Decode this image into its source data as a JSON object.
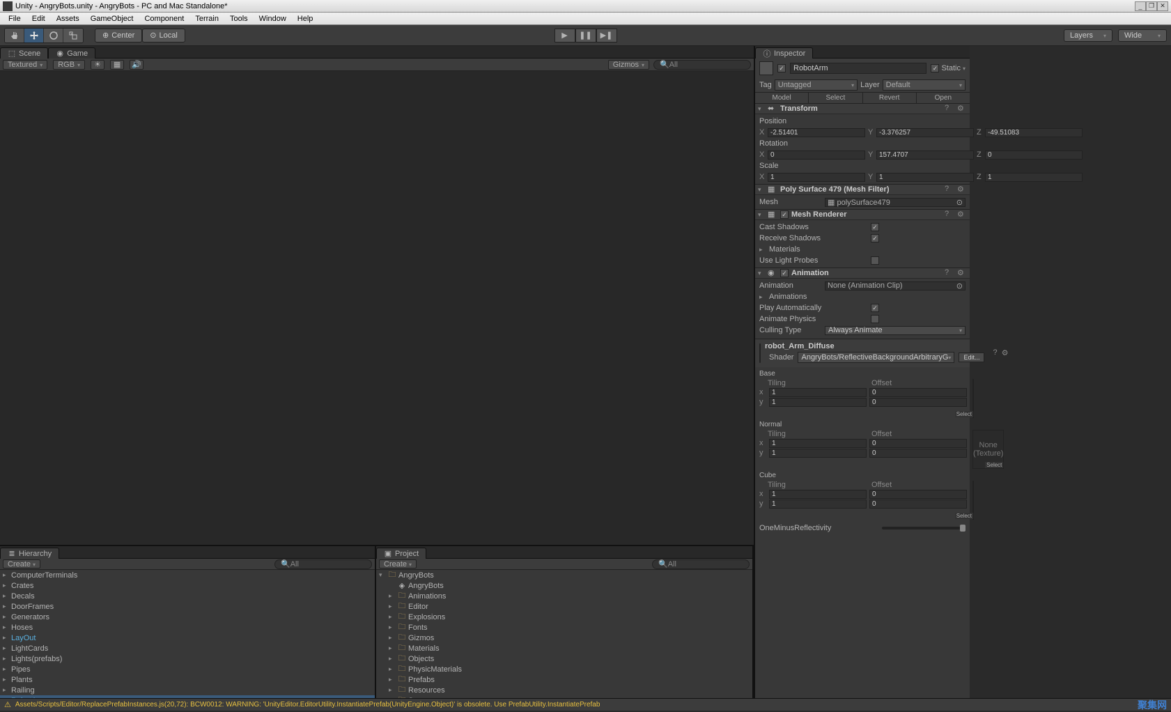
{
  "window": {
    "title": "Unity - AngryBots.unity - AngryBots - PC and Mac Standalone*"
  },
  "menu": [
    "File",
    "Edit",
    "Assets",
    "GameObject",
    "Component",
    "Terrain",
    "Tools",
    "Window",
    "Help"
  ],
  "toolbar": {
    "pivot_center": "Center",
    "pivot_local": "Local",
    "layers": "Layers",
    "layout": "Wide"
  },
  "sceneTabs": {
    "scene": "Scene",
    "game": "Game"
  },
  "sceneToolbar": {
    "shading": "Textured",
    "render": "RGB",
    "gizmos": "Gizmos",
    "search_placeholder": "All"
  },
  "viewport": {
    "overlay": ">>"
  },
  "hierarchy": {
    "tab": "Hierarchy",
    "create": "Create",
    "search_placeholder": "All",
    "items": [
      {
        "label": "ComputerTerminals"
      },
      {
        "label": "Crates"
      },
      {
        "label": "Decals"
      },
      {
        "label": "DoorFrames"
      },
      {
        "label": "Generators"
      },
      {
        "label": "Hoses"
      },
      {
        "label": "LayOut",
        "hl": true
      },
      {
        "label": "LightCards"
      },
      {
        "label": "Lights(prefabs)"
      },
      {
        "label": "Pipes"
      },
      {
        "label": "Plants"
      },
      {
        "label": "Railing"
      },
      {
        "label": "RobotArm",
        "hl": true,
        "sel": true
      }
    ]
  },
  "project": {
    "tab": "Project",
    "create": "Create",
    "search_placeholder": "All",
    "items": [
      {
        "label": "AngryBots",
        "icon": "folder",
        "open": true
      },
      {
        "label": "AngryBots",
        "icon": "scene"
      },
      {
        "label": "Animations",
        "icon": "folder"
      },
      {
        "label": "Editor",
        "icon": "folder"
      },
      {
        "label": "Explosions",
        "icon": "folder"
      },
      {
        "label": "Fonts",
        "icon": "folder"
      },
      {
        "label": "Gizmos",
        "icon": "folder"
      },
      {
        "label": "Materials",
        "icon": "folder"
      },
      {
        "label": "Objects",
        "icon": "folder"
      },
      {
        "label": "PhysicMaterials",
        "icon": "folder"
      },
      {
        "label": "Prefabs",
        "icon": "folder"
      },
      {
        "label": "Resources",
        "icon": "folder"
      },
      {
        "label": "Scenes",
        "icon": "folder"
      }
    ]
  },
  "inspector": {
    "tab": "Inspector",
    "object_name": "RobotArm",
    "static_label": "Static",
    "tag_label": "Tag",
    "tag_value": "Untagged",
    "layer_label": "Layer",
    "layer_value": "Default",
    "prefab_buttons": {
      "model": "Model",
      "select": "Select",
      "revert": "Revert",
      "open": "Open"
    },
    "transform": {
      "title": "Transform",
      "position_label": "Position",
      "position": {
        "x": "-2.51401",
        "y": "-3.376257",
        "z": "-49.51083"
      },
      "rotation_label": "Rotation",
      "rotation": {
        "x": "0",
        "y": "157.4707",
        "z": "0"
      },
      "scale_label": "Scale",
      "scale": {
        "x": "1",
        "y": "1",
        "z": "1"
      }
    },
    "meshfilter": {
      "title": "Poly Surface 479 (Mesh Filter)",
      "mesh_label": "Mesh",
      "mesh_value": "polySurface479"
    },
    "meshrenderer": {
      "title": "Mesh Renderer",
      "cast_shadows": "Cast Shadows",
      "receive_shadows": "Receive Shadows",
      "materials": "Materials",
      "use_light_probes": "Use Light Probes"
    },
    "animation": {
      "title": "Animation",
      "anim_label": "Animation",
      "anim_value": "None (Animation Clip)",
      "anims_label": "Animations",
      "play_auto": "Play Automatically",
      "anim_physics": "Animate Physics",
      "culling_label": "Culling Type",
      "culling_value": "Always Animate"
    },
    "material": {
      "name": "robot_Arm_Diffuse",
      "shader_label": "Shader",
      "shader_value": "AngryBots/ReflectiveBackgroundArbitraryG",
      "edit": "Edit...",
      "base_label": "Base",
      "normal_label": "Normal",
      "cube_label": "Cube",
      "tiling_label": "Tiling",
      "offset_label": "Offset",
      "select": "Select",
      "none_texture": "None\n(Texture)",
      "base": {
        "tx": "1",
        "ty": "1",
        "ox": "0",
        "oy": "0"
      },
      "normal": {
        "tx": "1",
        "ty": "1",
        "ox": "0",
        "oy": "0"
      },
      "cube": {
        "tx": "1",
        "ty": "1",
        "ox": "0",
        "oy": "0"
      },
      "reflectivity": "OneMinusReflectivity"
    }
  },
  "status": {
    "text": "Assets/Scripts/Editor/ReplacePrefabInstances.js(20,72): BCW0012: WARNING: 'UnityEditor.EditorUtility.InstantiatePrefab(UnityEngine.Object)' is obsolete. Use PrefabUtility.InstantiatePrefab",
    "watermark": "聚集网"
  },
  "labels": {
    "x": "X",
    "y": "Y",
    "z": "Z",
    "xl": "x",
    "yl": "y"
  }
}
